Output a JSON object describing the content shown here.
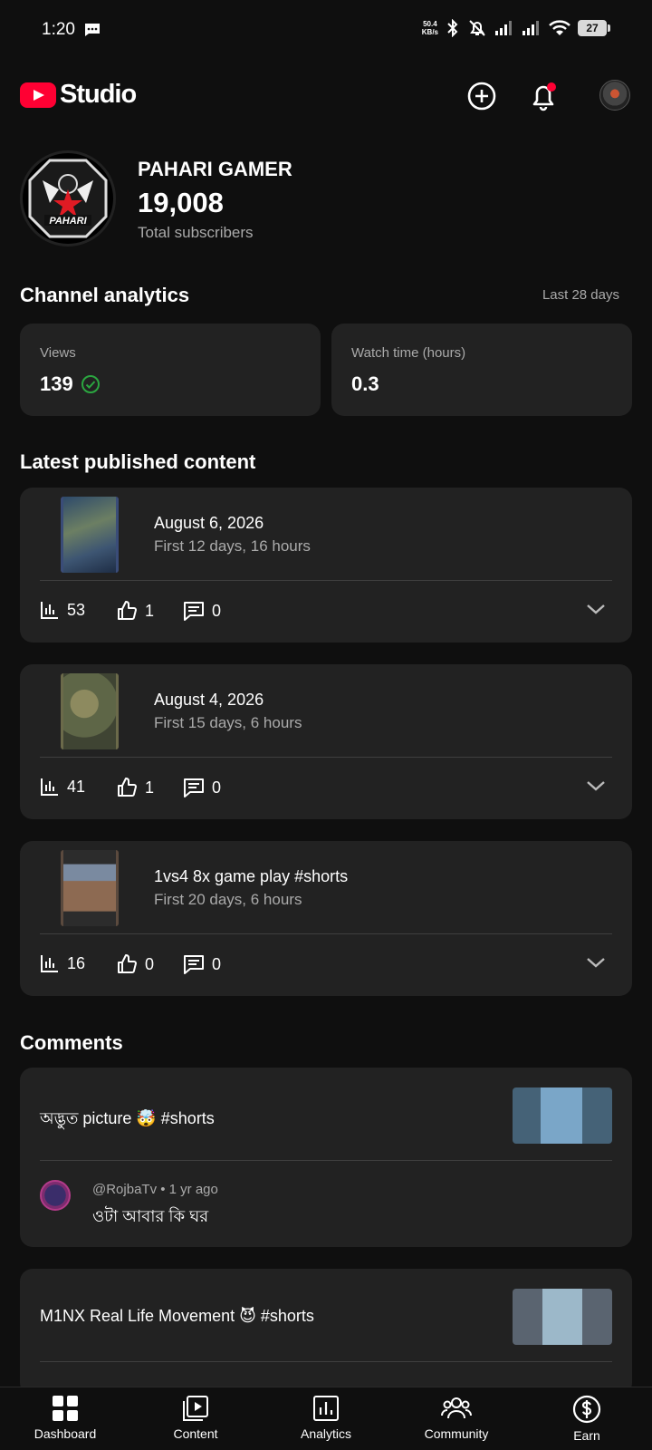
{
  "status_bar": {
    "time": "1:20",
    "net_speed_value": "50.4",
    "net_speed_unit": "KB/s",
    "battery": "27"
  },
  "header": {
    "brand": "Studio",
    "icons": [
      "create-icon",
      "notifications-icon",
      "account-avatar"
    ]
  },
  "channel": {
    "name": "PAHARI GAMER",
    "subscribers": "19,008",
    "subscribers_label": "Total subscribers",
    "avatar_text": "PAHARI"
  },
  "analytics": {
    "title": "Channel analytics",
    "range": "Last 28 days",
    "cards": [
      {
        "label": "Views",
        "value": "139"
      },
      {
        "label": "Watch time (hours)",
        "value": "0.3"
      }
    ]
  },
  "latest": {
    "title": "Latest published content",
    "items": [
      {
        "title": "August 6, 2026",
        "subtitle": "First 12 days, 16 hours",
        "views": "53",
        "likes": "1",
        "comments": "0"
      },
      {
        "title": "August 4, 2026",
        "subtitle": "First 15 days, 6 hours",
        "views": "41",
        "likes": "1",
        "comments": "0"
      },
      {
        "title": "1vs4 8x game play #shorts",
        "subtitle": "First 20 days, 6 hours",
        "views": "16",
        "likes": "0",
        "comments": "0"
      }
    ]
  },
  "comments": {
    "title": "Comments",
    "items": [
      {
        "video": "অদ্ভুত picture 🤯 #shorts",
        "author_meta": "@RojbaTv • 1 yr ago",
        "text": "ওটা আবার কি ঘর"
      },
      {
        "video": "M1NX Real Life Movement 😈 #shorts"
      }
    ]
  },
  "bottom_nav": [
    {
      "label": "Dashboard"
    },
    {
      "label": "Content"
    },
    {
      "label": "Analytics"
    },
    {
      "label": "Community"
    },
    {
      "label": "Earn"
    }
  ],
  "colors": {
    "background": "#0f0f0f",
    "card": "#222222",
    "brand_red": "#ff0033",
    "success_green": "#2ba640",
    "muted_text": "#aaaaaa"
  }
}
